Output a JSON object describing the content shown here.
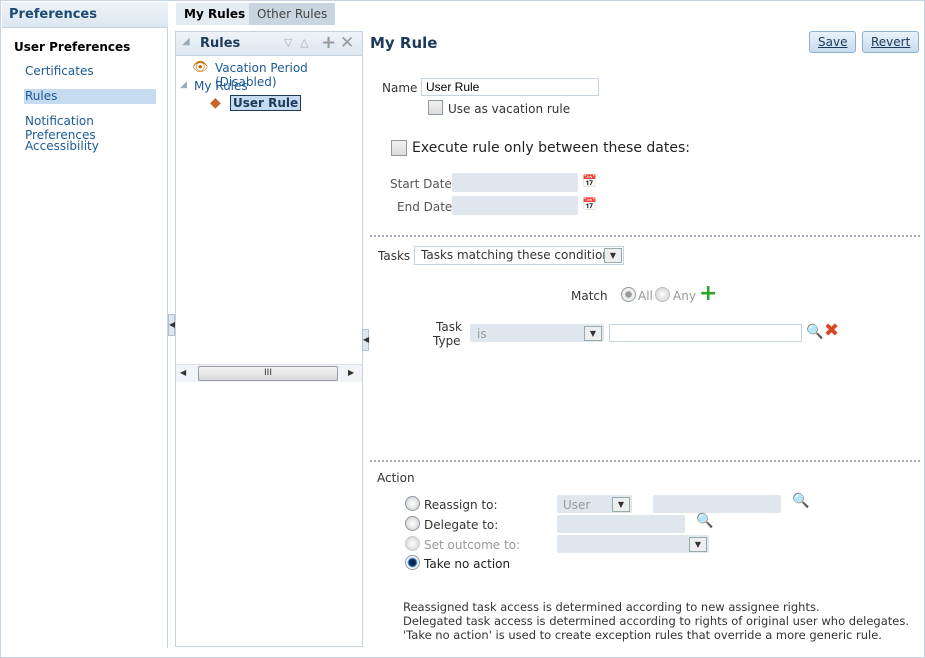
{
  "sidebar": {
    "title": "Preferences",
    "section": "User Preferences",
    "items": [
      {
        "label": "Certificates"
      },
      {
        "label": "Rules",
        "selected": true
      },
      {
        "label": "Notification Preferences"
      },
      {
        "label": "Accessibility"
      }
    ]
  },
  "tabs": [
    {
      "label": "My Rules",
      "active": true
    },
    {
      "label": "Other Rules"
    }
  ],
  "rules_panel": {
    "title": "Rules",
    "items": {
      "vacation": "Vacation Period (Disabled)",
      "group": "My Rules",
      "rule": "User Rule"
    },
    "scroll_thumb": "III"
  },
  "detail": {
    "title": "My Rule",
    "save": "Save",
    "revert": "Revert",
    "name_label": "Name",
    "name_value": "User Rule",
    "vacation_rule": "Use as vacation rule",
    "execute_dates": "Execute rule only between these dates:",
    "start_date": "Start Date",
    "end_date": "End Date",
    "tasks_label": "Tasks",
    "tasks_value": "Tasks matching these conditions",
    "match_label": "Match",
    "match_all": "All",
    "match_any": "Any",
    "task_type_label_1": "Task",
    "task_type_label_2": "Type",
    "operator": "is",
    "action_label": "Action",
    "actions": {
      "reassign": "Reassign to:",
      "reassign_type": "User",
      "delegate": "Delegate to:",
      "outcome": "Set outcome to:",
      "none": "Take no action"
    },
    "selected_action": "Take no action",
    "notes": [
      "Reassigned task access is determined according to new assignee rights.",
      "Delegated task access is determined according to rights of original user who delegates.",
      "'Take no action' is used to create exception rules that override a more generic rule."
    ]
  }
}
